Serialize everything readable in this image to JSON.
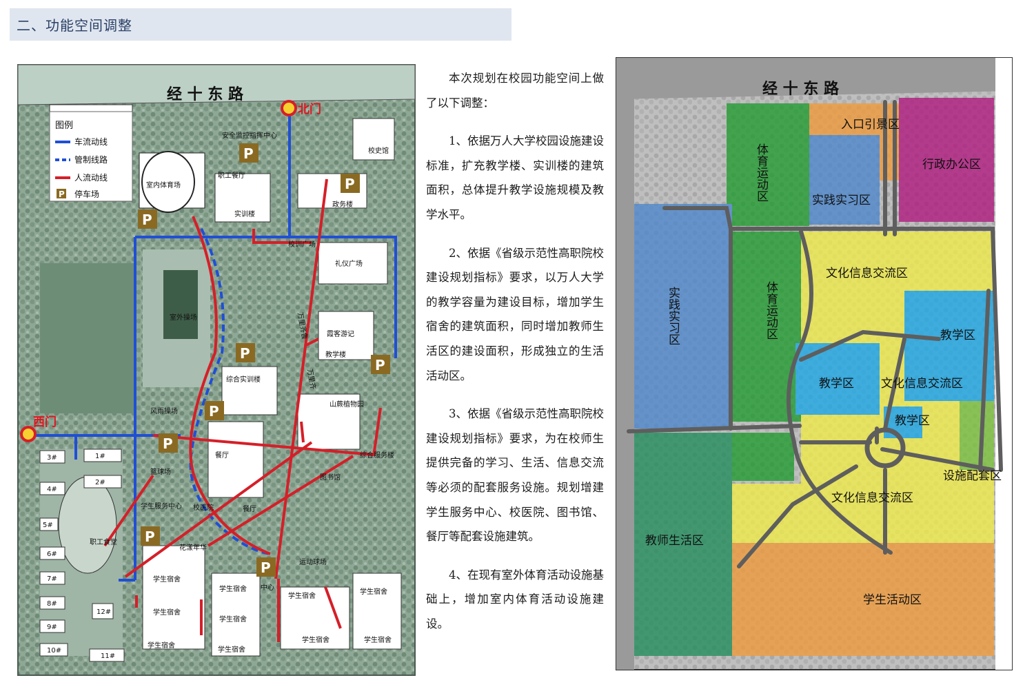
{
  "header": {
    "title": "二、功能空间调整"
  },
  "left_map": {
    "road_name": "经 十 东 路",
    "gates": {
      "north": "北门",
      "west": "西门"
    },
    "legend": {
      "title": "图例",
      "items": [
        {
          "label": "车流动线",
          "color": "#1f4fd6",
          "style": "solid"
        },
        {
          "label": "管制线路",
          "color": "#1f4fd6",
          "style": "dashed"
        },
        {
          "label": "人流动线",
          "color": "#d51f28",
          "style": "solid"
        },
        {
          "label": "停车场",
          "icon": "parking-icon"
        }
      ]
    },
    "parking_symbol": "P",
    "buildings": {
      "indoor_gym": "室内体育场",
      "security": "安全监控指挥中心",
      "staff_canteen": "职工餐厅",
      "training": "实训楼",
      "history_museum": "校史馆",
      "admin_bldg": "政务楼",
      "training_square": "校训广场",
      "ceremony": "礼仪广场",
      "outdoor_field": "室外操场",
      "teaching": "教学楼",
      "tower_note": "霞客游记",
      "comprehensive": "综合实训楼",
      "wanli1": "万里齐鲁",
      "wanli2": "万里齐",
      "plant_garden": "山蕨植物园",
      "sports_court": "风雨操场",
      "service": "综合服务楼",
      "canteen": "餐厅",
      "basketball": "篮球场",
      "library": "图书馆",
      "student_service": "学生服务中心",
      "hospital": "校医院",
      "staff_canteen2": "职工食堂",
      "flower": "花漾年华",
      "sports_field": "运动球场",
      "dorm": "学生宿舍",
      "zhongxin": "中心",
      "housing": [
        "3#",
        "1#",
        "4#",
        "2#",
        "5#",
        "6#",
        "7#",
        "8#",
        "12#",
        "9#",
        "10#",
        "11#"
      ]
    }
  },
  "right_map": {
    "road_name": "经 十 东 路",
    "zones": {
      "entrance": "入口引景区",
      "admin": "行政办公区",
      "sports1": "体育运动区",
      "practice1": "实践实习区",
      "practice2": "实践实习区",
      "culture1": "文化信息交流区",
      "sports2": "体育运动区",
      "teaching1": "教学区",
      "teaching2": "教学区",
      "culture2": "文化信息交流区",
      "teaching3": "教学区",
      "facility": "设施配套区",
      "culture3": "文化信息交流区",
      "staff_living": "教师生活区",
      "student_activity": "学生活动区"
    },
    "zone_colors": {
      "green": "#1f9a2e",
      "orange": "#f09a3a",
      "blue": "#4b86cc",
      "magenta": "#b0177d",
      "yellow": "#f2ec48",
      "cyan": "#1aa7e6",
      "teal": "#1f8c5b",
      "lime": "#7cc23a"
    }
  },
  "text": {
    "paragraphs": [
      "本次规划在校园功能空间上做了以下调整：",
      "1、依据万人大学校园设施建设标准，扩充教学楼、实训楼的建筑面积，总体提升教学设施规模及教学水平。",
      "2、依据《省级示范性高职院校建设规划指标》要求，以万人大学的教学容量为建设目标，增加学生宿舍的建筑面积，同时增加教师生活区的建设面积，形成独立的生活活动区。",
      "3、依据《省级示范性高职院校建设规划指标》要求，为在校师生提供完备的学习、生活、信息交流等必须的配套服务设施。规划增建学生服务中心、校医院、图书馆、餐厅等配套设施建筑。",
      "4、在现有室外体育活动设施基础上，增加室内体育活动设施建设。"
    ]
  }
}
